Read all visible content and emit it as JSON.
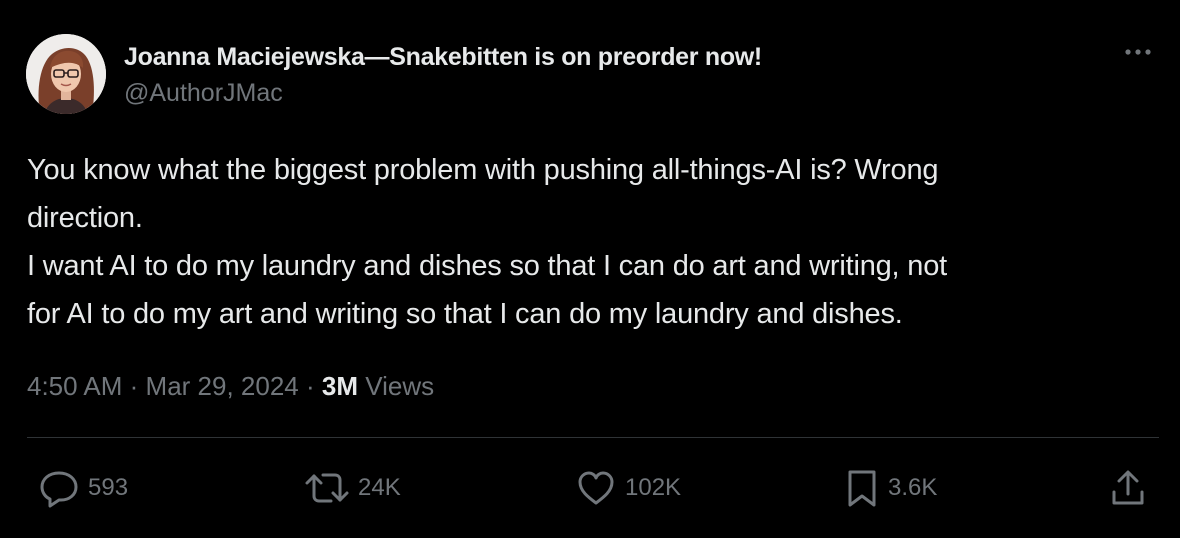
{
  "author": {
    "display_name": "Joanna Maciejewska—Snakebitten is on preorder now!",
    "handle": "@AuthorJMac"
  },
  "tweet": {
    "text_lines": [
      "You know what the biggest problem with pushing all-things-AI is? Wrong",
      "direction.",
      "I want AI to do my laundry and dishes so that I can do art and writing, not",
      "for AI to do my art and writing so that I can do my laundry and dishes."
    ],
    "time": "4:50 AM",
    "separator": "·",
    "date": "Mar 29, 2024",
    "views_count": "3M",
    "views_label": "Views"
  },
  "actions": {
    "replies": "593",
    "reposts": "24K",
    "likes": "102K",
    "bookmarks": "3.6K"
  },
  "colors": {
    "background": "#000000",
    "primary_text": "#e7e9ea",
    "secondary_text": "#71767b",
    "divider": "#2f3336"
  }
}
